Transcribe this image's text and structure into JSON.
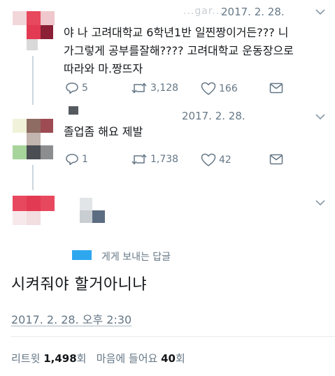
{
  "tweets": [
    {
      "name_blurred": "...gar...",
      "date": "2017. 2. 28.",
      "lines": [
        "야 나 고려대학교 6학년1반 일찐짱이거든??? 니",
        "가그렇게 공부를잘해???? 고려대학교 운동장으로",
        "따라와 마.짱뜨자"
      ],
      "replies": "5",
      "retweets": "3,128",
      "likes": "166"
    },
    {
      "date": "2017. 2. 28.",
      "lines": [
        "졸업좀 해요 제발"
      ],
      "replies": "1",
      "retweets": "1,738",
      "likes": "42"
    }
  ],
  "main": {
    "reply_to_suffix": "게게 보내는 답글",
    "text": "시켜줘야 할거아니냐",
    "timestamp": "2017. 2. 28. 오후 2:30",
    "stats": {
      "retweet_label": "리트윗",
      "retweet_count": "1,498",
      "retweet_unit": "회",
      "like_label": "마음에 들어요",
      "like_count": "40",
      "like_unit": "회"
    }
  },
  "colors": {
    "link": "#1da1f2",
    "muted": "#657786",
    "text": "#14171a"
  },
  "icons": [
    "reply-icon",
    "retweet-icon",
    "heart-icon",
    "dm-icon",
    "chevron-down-icon"
  ]
}
